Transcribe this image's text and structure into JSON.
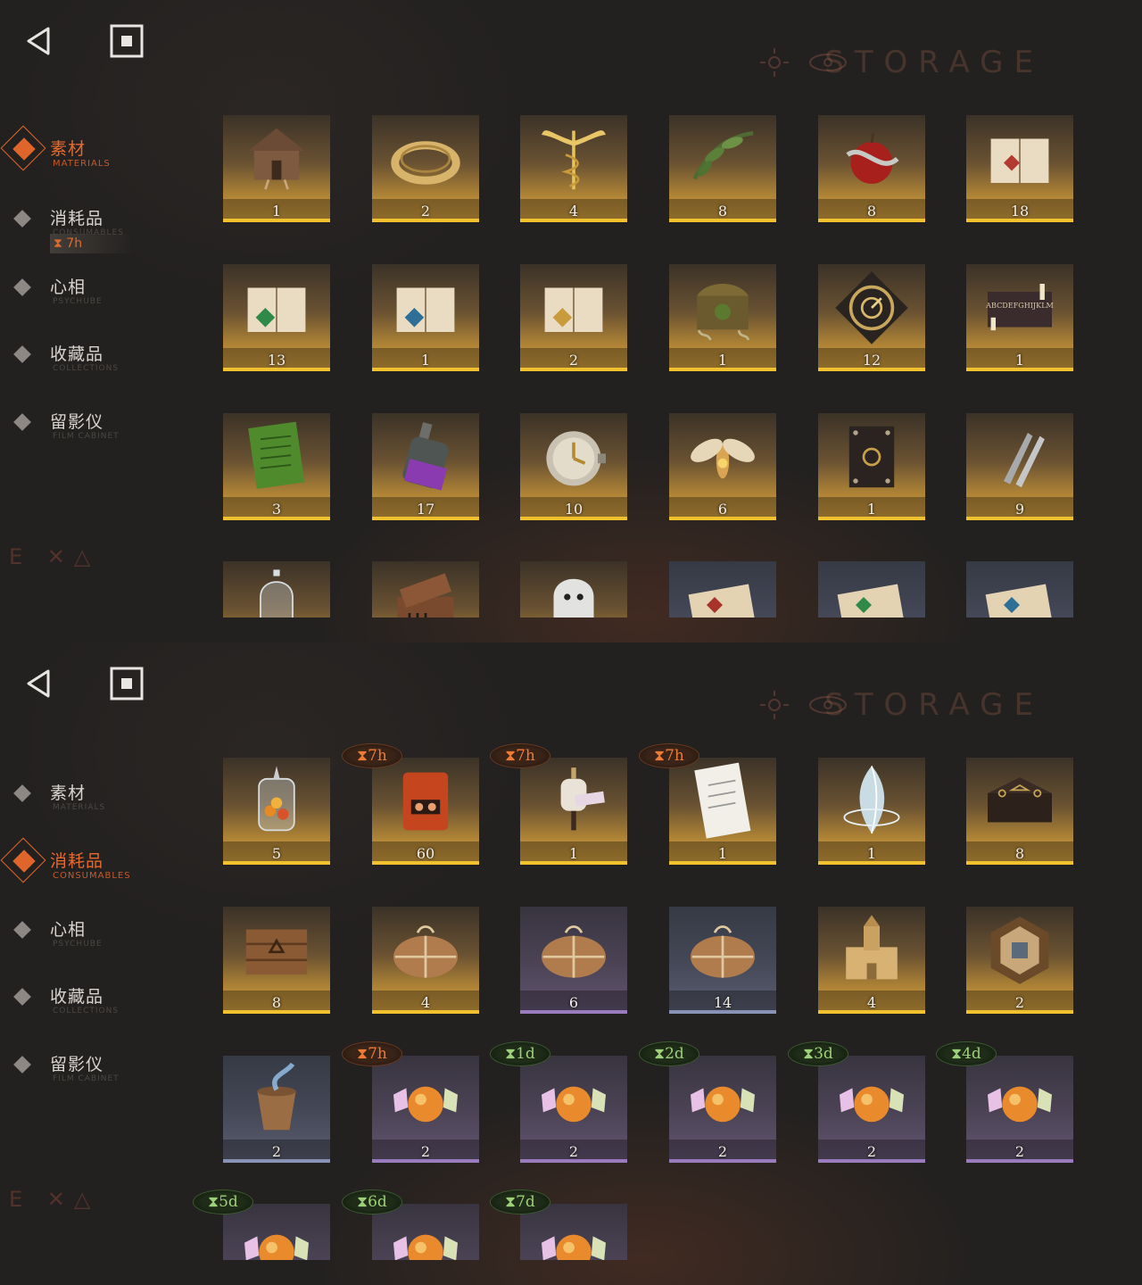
{
  "top_panel": {
    "watermark": "STORAGE",
    "corner_mark": "E ✕△",
    "nav": [
      {
        "label": "素材",
        "sub": "MATERIALS",
        "active": true
      },
      {
        "label": "消耗品",
        "sub": "CONSUMABLES",
        "active": false,
        "timer": "7h"
      },
      {
        "label": "心相",
        "sub": "PSYCHUBE",
        "active": false
      },
      {
        "label": "收藏品",
        "sub": "COLLECTIONS",
        "active": false
      },
      {
        "label": "留影仪",
        "sub": "FILM CABINET",
        "active": false
      }
    ],
    "items": [
      {
        "name": "hut-icon",
        "count": "1",
        "tier": "gold"
      },
      {
        "name": "ring-icon",
        "count": "2",
        "tier": "gold"
      },
      {
        "name": "caduceus-icon",
        "count": "4",
        "tier": "gold"
      },
      {
        "name": "laurel-icon",
        "count": "8",
        "tier": "gold"
      },
      {
        "name": "apple-snake-icon",
        "count": "8",
        "tier": "gold"
      },
      {
        "name": "red-book-icon",
        "count": "18",
        "tier": "gold"
      },
      {
        "name": "green-book-icon",
        "count": "13",
        "tier": "gold"
      },
      {
        "name": "blue-book-icon",
        "count": "1",
        "tier": "gold"
      },
      {
        "name": "gold-book-icon",
        "count": "2",
        "tier": "gold"
      },
      {
        "name": "root-chest-icon",
        "count": "1",
        "tier": "gold"
      },
      {
        "name": "clockwork-icon",
        "count": "12",
        "tier": "gold"
      },
      {
        "name": "ouija-icon",
        "count": "1",
        "tier": "gold"
      },
      {
        "name": "green-tablet-icon",
        "count": "3",
        "tier": "gold"
      },
      {
        "name": "bottle-icon",
        "count": "17",
        "tier": "gold"
      },
      {
        "name": "pocket-watch-icon",
        "count": "10",
        "tier": "gold"
      },
      {
        "name": "moth-icon",
        "count": "6",
        "tier": "gold"
      },
      {
        "name": "dark-book-icon",
        "count": "1",
        "tier": "gold"
      },
      {
        "name": "bullets-icon",
        "count": "9",
        "tier": "gold"
      },
      {
        "name": "bell-jar-icon",
        "count": "",
        "tier": "gold"
      },
      {
        "name": "music-box-icon",
        "count": "",
        "tier": "gold"
      },
      {
        "name": "ghost-icon",
        "count": "",
        "tier": "gold"
      },
      {
        "name": "red-scroll-icon",
        "count": "",
        "tier": "blue"
      },
      {
        "name": "green-scroll-icon",
        "count": "",
        "tier": "blue"
      },
      {
        "name": "blue-scroll-icon",
        "count": "",
        "tier": "blue"
      }
    ]
  },
  "bottom_panel": {
    "watermark": "STORAGE",
    "corner_mark": "E ✕△",
    "nav": [
      {
        "label": "素材",
        "sub": "MATERIALS",
        "active": false
      },
      {
        "label": "消耗品",
        "sub": "CONSUMABLES",
        "active": true
      },
      {
        "label": "心相",
        "sub": "PSYCHUBE",
        "active": false
      },
      {
        "label": "收藏品",
        "sub": "COLLECTIONS",
        "active": false
      },
      {
        "label": "留影仪",
        "sub": "FILM CABINET",
        "active": false
      }
    ],
    "items": [
      {
        "name": "candy-jar-icon",
        "count": "5",
        "tier": "gold",
        "timer": "",
        "timer_color": ""
      },
      {
        "name": "red-device-icon",
        "count": "60",
        "tier": "gold",
        "timer": "7h",
        "timer_color": "orange"
      },
      {
        "name": "mannequin-icon",
        "count": "1",
        "tier": "gold",
        "timer": "7h",
        "timer_color": "orange"
      },
      {
        "name": "shopping-list-icon",
        "count": "1",
        "tier": "gold",
        "timer": "7h",
        "timer_color": "orange"
      },
      {
        "name": "crystal-icon",
        "count": "1",
        "tier": "gold",
        "timer": "",
        "timer_color": ""
      },
      {
        "name": "rune-table-icon",
        "count": "8",
        "tier": "gold",
        "timer": "",
        "timer_color": ""
      },
      {
        "name": "crate-icon",
        "count": "8",
        "tier": "gold",
        "timer": "",
        "timer_color": ""
      },
      {
        "name": "parcel-icon",
        "count": "4",
        "tier": "gold",
        "timer": "",
        "timer_color": ""
      },
      {
        "name": "parcel-icon",
        "count": "6",
        "tier": "purple",
        "timer": "",
        "timer_color": ""
      },
      {
        "name": "parcel-icon",
        "count": "14",
        "tier": "blue",
        "timer": "",
        "timer_color": ""
      },
      {
        "name": "sandcastle-icon",
        "count": "4",
        "tier": "gold",
        "timer": "",
        "timer_color": ""
      },
      {
        "name": "hex-puzzle-icon",
        "count": "2",
        "tier": "gold",
        "timer": "",
        "timer_color": ""
      },
      {
        "name": "bucket-icon",
        "count": "2",
        "tier": "blue",
        "timer": "",
        "timer_color": ""
      },
      {
        "name": "candy-icon",
        "count": "2",
        "tier": "purple",
        "timer": "7h",
        "timer_color": "orange"
      },
      {
        "name": "candy-icon",
        "count": "2",
        "tier": "purple",
        "timer": "1d",
        "timer_color": "green"
      },
      {
        "name": "candy-icon",
        "count": "2",
        "tier": "purple",
        "timer": "2d",
        "timer_color": "green"
      },
      {
        "name": "candy-icon",
        "count": "2",
        "tier": "purple",
        "timer": "3d",
        "timer_color": "green"
      },
      {
        "name": "candy-icon",
        "count": "2",
        "tier": "purple",
        "timer": "4d",
        "timer_color": "green"
      },
      {
        "name": "candy-icon",
        "count": "",
        "tier": "purple",
        "timer": "5d",
        "timer_color": "green"
      },
      {
        "name": "candy-icon",
        "count": "",
        "tier": "purple",
        "timer": "6d",
        "timer_color": "green"
      },
      {
        "name": "candy-icon",
        "count": "",
        "tier": "purple",
        "timer": "7d",
        "timer_color": "green"
      }
    ]
  }
}
